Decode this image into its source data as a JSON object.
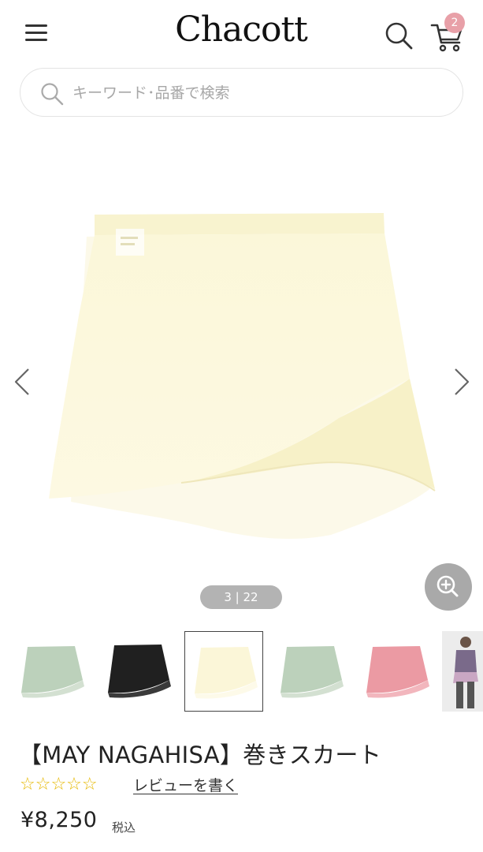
{
  "header": {
    "logo": "Chacott",
    "cart_count": "2"
  },
  "search": {
    "placeholder": "キーワード･品番で検索"
  },
  "gallery": {
    "counter": "3 | 22",
    "current_index": 3,
    "total": 22
  },
  "thumbnails": [
    {
      "color": "#bcd1bb",
      "label": "mint"
    },
    {
      "color": "#202020",
      "label": "black"
    },
    {
      "color": "#fbf6d8",
      "label": "cream"
    },
    {
      "color": "#bcd1bb",
      "label": "mint"
    },
    {
      "color": "#eb9aa3",
      "label": "pink"
    },
    {
      "color": "#8a8a8a",
      "label": "model"
    }
  ],
  "product": {
    "title": "【MAY NAGAHISA】巻きスカート",
    "stars": "☆☆☆☆☆",
    "rating": 0,
    "review_link": "レビューを書く",
    "price": "¥8,250",
    "tax_note": "税込"
  }
}
